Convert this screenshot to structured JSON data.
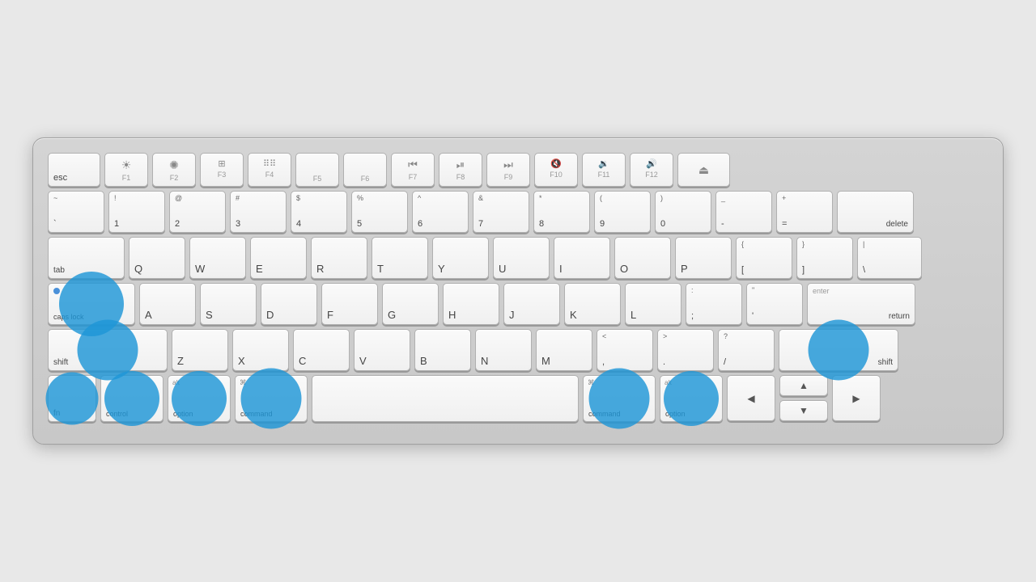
{
  "keyboard": {
    "rows": {
      "fn_row": [
        {
          "id": "esc",
          "label": "esc",
          "width": "w-esc",
          "top": "",
          "icon": ""
        },
        {
          "id": "f1",
          "label": "F1",
          "width": "w-fn",
          "top": "",
          "icon": "☀"
        },
        {
          "id": "f2",
          "label": "F2",
          "width": "w-fn",
          "top": "",
          "icon": "☀"
        },
        {
          "id": "f3",
          "label": "F3",
          "width": "w-fn",
          "top": "",
          "icon": "⊞"
        },
        {
          "id": "f4",
          "label": "F4",
          "width": "w-fn",
          "top": "",
          "icon": "⊞⊞"
        },
        {
          "id": "f5",
          "label": "F5",
          "width": "w-fn",
          "top": "",
          "icon": ""
        },
        {
          "id": "f6",
          "label": "F6",
          "width": "w-fn",
          "top": "",
          "icon": ""
        },
        {
          "id": "f7",
          "label": "F7",
          "width": "w-fn",
          "top": "",
          "icon": "⏮"
        },
        {
          "id": "f8",
          "label": "F8",
          "width": "w-fn",
          "top": "",
          "icon": "⏯"
        },
        {
          "id": "f9",
          "label": "F9",
          "width": "w-fn",
          "top": "",
          "icon": "⏭"
        },
        {
          "id": "f10",
          "label": "F10",
          "width": "w-fn",
          "top": "",
          "icon": "🔇"
        },
        {
          "id": "f11",
          "label": "F11",
          "width": "w-fn",
          "top": "",
          "icon": "🔉"
        },
        {
          "id": "f12",
          "label": "F12",
          "width": "w-fn",
          "top": "",
          "icon": "🔊"
        },
        {
          "id": "eject",
          "label": "",
          "width": "w-eject",
          "top": "",
          "icon": "⏏"
        }
      ],
      "num_row": [
        {
          "id": "tilde",
          "top": "~",
          "bottom": "`",
          "width": "w-std"
        },
        {
          "id": "1",
          "top": "!",
          "bottom": "1",
          "width": "w-std"
        },
        {
          "id": "2",
          "top": "@",
          "bottom": "2",
          "width": "w-std"
        },
        {
          "id": "3",
          "top": "#",
          "bottom": "3",
          "width": "w-std"
        },
        {
          "id": "4",
          "top": "$",
          "bottom": "4",
          "width": "w-std"
        },
        {
          "id": "5",
          "top": "%",
          "bottom": "5",
          "width": "w-std"
        },
        {
          "id": "6",
          "top": "^",
          "bottom": "6",
          "width": "w-std"
        },
        {
          "id": "7",
          "top": "&",
          "bottom": "7",
          "width": "w-std"
        },
        {
          "id": "8",
          "top": "*",
          "bottom": "8",
          "width": "w-std"
        },
        {
          "id": "9",
          "top": "(",
          "bottom": "9",
          "width": "w-std"
        },
        {
          "id": "0",
          "top": ")",
          "bottom": "0",
          "width": "w-std"
        },
        {
          "id": "minus",
          "top": "_",
          "bottom": "-",
          "width": "w-std"
        },
        {
          "id": "equals",
          "top": "+",
          "bottom": "=",
          "width": "w-std"
        },
        {
          "id": "delete",
          "top": "",
          "bottom": "delete",
          "width": "w-delete"
        }
      ],
      "qwerty_row": [
        {
          "id": "tab",
          "label": "tab",
          "width": "w-tab"
        },
        {
          "id": "q",
          "label": "Q",
          "width": "w-std"
        },
        {
          "id": "w",
          "label": "W",
          "width": "w-std"
        },
        {
          "id": "e",
          "label": "E",
          "width": "w-std"
        },
        {
          "id": "r",
          "label": "R",
          "width": "w-std"
        },
        {
          "id": "t",
          "label": "T",
          "width": "w-std"
        },
        {
          "id": "y",
          "label": "Y",
          "width": "w-std"
        },
        {
          "id": "u",
          "label": "U",
          "width": "w-std"
        },
        {
          "id": "i",
          "label": "I",
          "width": "w-std"
        },
        {
          "id": "o",
          "label": "O",
          "width": "w-std"
        },
        {
          "id": "p",
          "label": "P",
          "width": "w-std"
        },
        {
          "id": "lbracket",
          "top": "{",
          "bottom": "[",
          "width": "w-std"
        },
        {
          "id": "rbracket",
          "top": "}",
          "bottom": "]",
          "width": "w-std"
        },
        {
          "id": "backslash",
          "top": "|",
          "bottom": "\\",
          "width": "w-backslash"
        }
      ],
      "home_row": [
        {
          "id": "caps",
          "label": "caps lock",
          "width": "w-caps",
          "highlight": true
        },
        {
          "id": "a",
          "label": "A",
          "width": "w-std"
        },
        {
          "id": "s",
          "label": "S",
          "width": "w-std"
        },
        {
          "id": "d",
          "label": "D",
          "width": "w-std"
        },
        {
          "id": "f",
          "label": "F",
          "width": "w-std"
        },
        {
          "id": "g",
          "label": "G",
          "width": "w-std"
        },
        {
          "id": "h",
          "label": "H",
          "width": "w-std"
        },
        {
          "id": "j",
          "label": "J",
          "width": "w-std"
        },
        {
          "id": "k",
          "label": "K",
          "width": "w-std"
        },
        {
          "id": "l",
          "label": "L",
          "width": "w-std"
        },
        {
          "id": "semi",
          "top": ":",
          "bottom": ";",
          "width": "w-std"
        },
        {
          "id": "quote",
          "top": "\"",
          "bottom": "'",
          "width": "w-std"
        },
        {
          "id": "enter",
          "label": "return",
          "sublabel": "enter",
          "width": "w-enter"
        }
      ],
      "shift_row": [
        {
          "id": "shift-l",
          "label": "shift",
          "width": "w-shift-l",
          "highlight": true
        },
        {
          "id": "z",
          "label": "Z",
          "width": "w-std"
        },
        {
          "id": "x",
          "label": "X",
          "width": "w-std"
        },
        {
          "id": "c",
          "label": "C",
          "width": "w-std"
        },
        {
          "id": "v",
          "label": "V",
          "width": "w-std"
        },
        {
          "id": "b",
          "label": "B",
          "width": "w-std"
        },
        {
          "id": "n",
          "label": "N",
          "width": "w-std"
        },
        {
          "id": "m",
          "label": "M",
          "width": "w-std"
        },
        {
          "id": "comma",
          "top": "<",
          "bottom": ",",
          "width": "w-std"
        },
        {
          "id": "period",
          "top": ">",
          "bottom": ".",
          "width": "w-std"
        },
        {
          "id": "slash",
          "top": "?",
          "bottom": "/",
          "width": "w-std"
        },
        {
          "id": "shift-r",
          "label": "shift",
          "width": "w-shift-r",
          "highlight": true
        }
      ],
      "bottom_row": [
        {
          "id": "fn",
          "label": "fn",
          "width": "w-fn-key",
          "highlight": true
        },
        {
          "id": "control",
          "label": "control",
          "width": "w-ctrl",
          "highlight": true
        },
        {
          "id": "option-l",
          "label": "option",
          "sublabel": "alt",
          "width": "w-opt",
          "highlight": true
        },
        {
          "id": "command-l",
          "label": "command",
          "sublabel": "⌘",
          "width": "w-cmd-l",
          "highlight": true
        },
        {
          "id": "space",
          "label": "",
          "width": "w-space"
        },
        {
          "id": "command-r",
          "label": "command",
          "sublabel": "⌘",
          "width": "w-cmd-r",
          "highlight": true
        },
        {
          "id": "option-r",
          "label": "option",
          "sublabel": "alt",
          "width": "w-opt",
          "highlight": true
        }
      ]
    }
  }
}
